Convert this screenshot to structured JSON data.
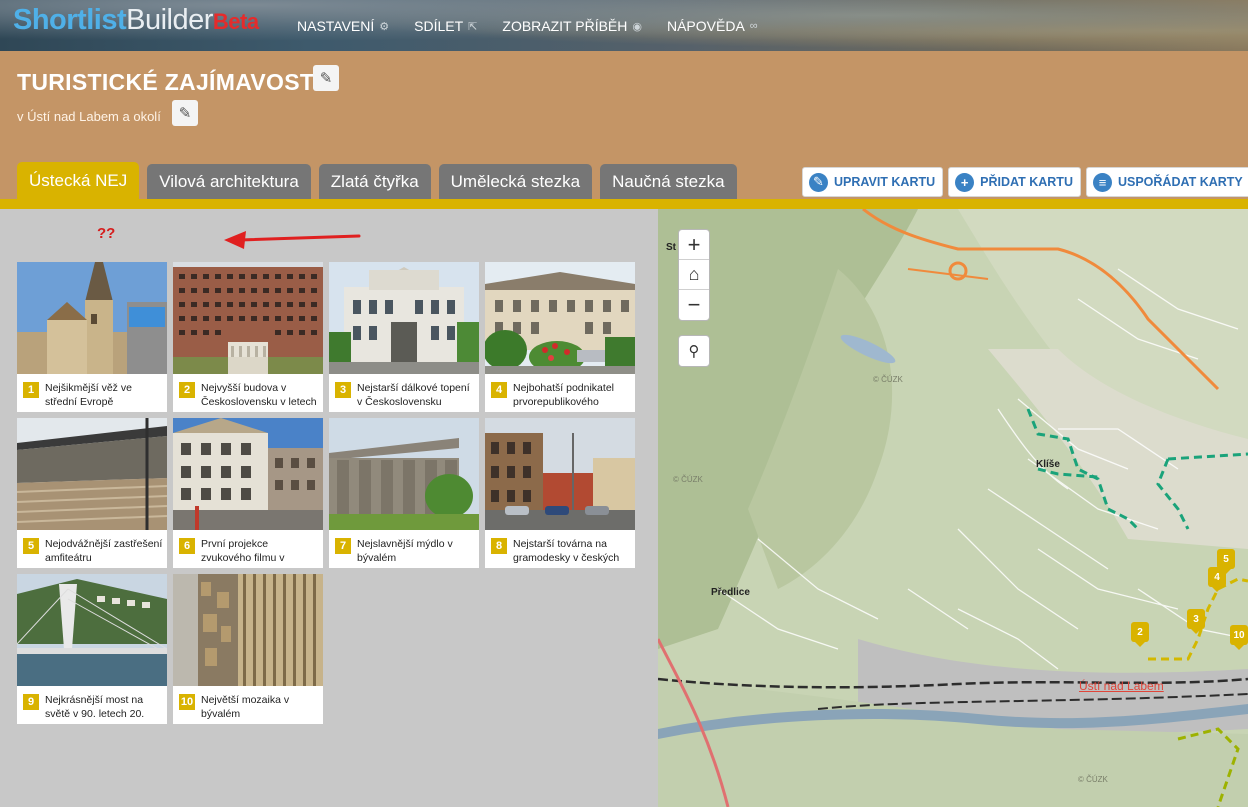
{
  "app": {
    "logo_part1": "Shortlist",
    "logo_part2": "Builder",
    "logo_badge": "Beta"
  },
  "topnav": [
    {
      "label": "NASTAVENÍ",
      "icon": "gears-icon"
    },
    {
      "label": "SDÍLET",
      "icon": "share-icon"
    },
    {
      "label": "ZOBRAZIT PŘÍBĚH",
      "icon": "eye-icon"
    },
    {
      "label": "NÁPOVĚDA",
      "icon": "binoculars-icon"
    }
  ],
  "header": {
    "title": "TURISTICKÉ ZAJÍMAVOSTI",
    "subtitle": "v Ústí nad Labem a okolí"
  },
  "tabs": [
    {
      "label": "Ústecká NEJ",
      "active": true
    },
    {
      "label": "Vilová architektura",
      "active": false
    },
    {
      "label": "Zlatá čtyřka",
      "active": false
    },
    {
      "label": "Umělecká stezka",
      "active": false
    },
    {
      "label": "Naučná stezka",
      "active": false
    }
  ],
  "actions": [
    {
      "label": "UPRAVIT KARTU",
      "icon": "pencil-icon"
    },
    {
      "label": "PŘIDAT KARTU",
      "icon": "plus-icon"
    },
    {
      "label": "USPOŘÁDAT KARTY",
      "icon": "list-icon"
    }
  ],
  "annotation": {
    "text": "??",
    "arrow_color": "#e02020"
  },
  "cards": [
    {
      "num": "1",
      "text": "Nejšikmější věž ve střední Evropě"
    },
    {
      "num": "2",
      "text": "Nejvyšší budova v Československu v letech"
    },
    {
      "num": "3",
      "text": "Nejstarší dálkové topení v Československu"
    },
    {
      "num": "4",
      "text": "Nejbohatší podnikatel prvorepublikového"
    },
    {
      "num": "5",
      "text": "Nejodvážnější zastřešení amfiteátru"
    },
    {
      "num": "6",
      "text": "První projekce zvukového filmu v"
    },
    {
      "num": "7",
      "text": "Nejslavnější mýdlo v bývalém"
    },
    {
      "num": "8",
      "text": "Nejstarší továrna na gramodesky v českých"
    },
    {
      "num": "9",
      "text": "Nejkrásnější most na světě v 90. letech 20."
    },
    {
      "num": "10",
      "text": "Největší mozaika v bývalém"
    }
  ],
  "map": {
    "labels": {
      "klise": "Klíše",
      "predlice": "Předlice",
      "city": "Ústí nad Labem",
      "st": "St",
      "copy1": "© ČÚZK",
      "copy2": "© ČÚZK",
      "copy3": "© ČÚZK"
    },
    "markers": [
      "5",
      "4",
      "3",
      "2",
      "10"
    ]
  },
  "colors": {
    "accent": "#d9b300",
    "header": "#c49566",
    "tab_inactive": "#767676",
    "link_blue": "#2f6fb3"
  }
}
